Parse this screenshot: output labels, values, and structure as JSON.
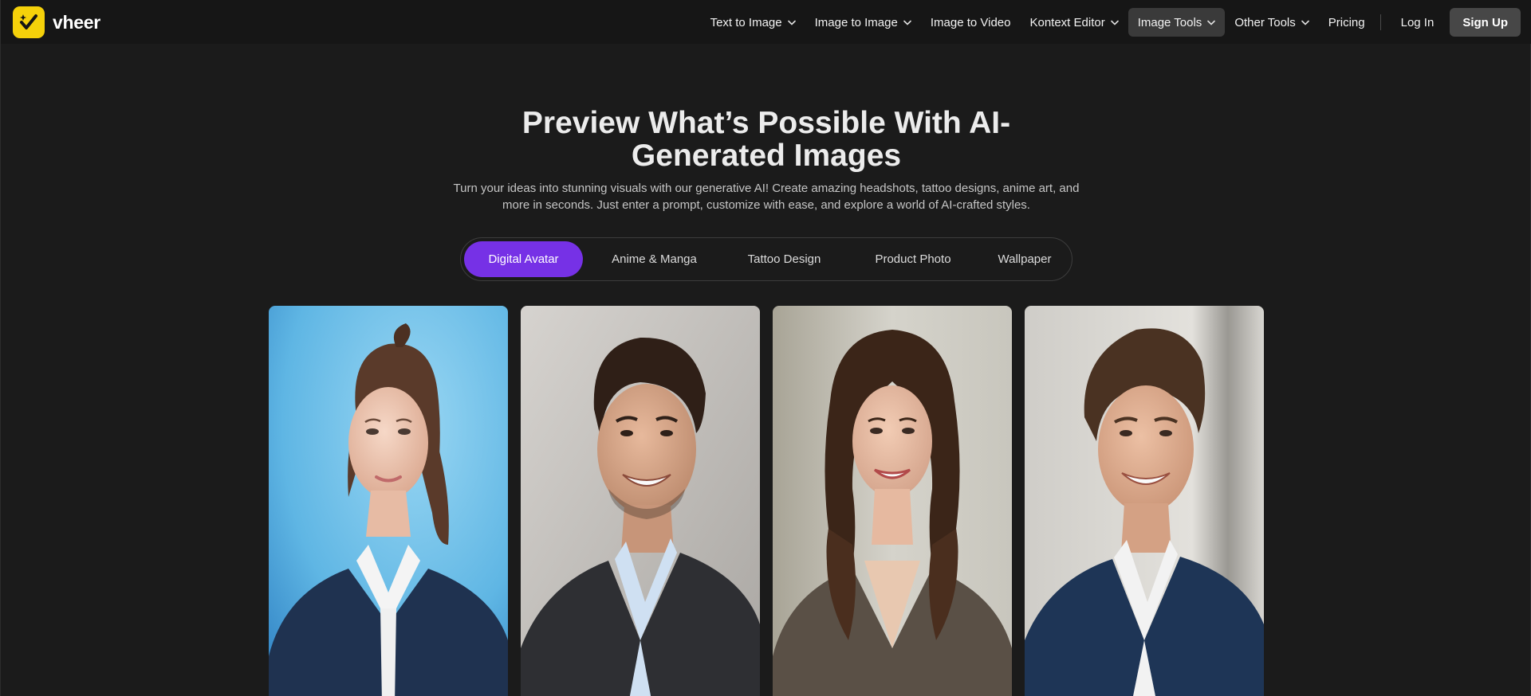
{
  "brand": {
    "name": "vheer",
    "logo_icon": "check-star-logo-icon",
    "logo_color": "#f5d10a"
  },
  "nav": {
    "items": [
      {
        "label": "Text to Image",
        "dropdown": true,
        "active": false
      },
      {
        "label": "Image to Image",
        "dropdown": true,
        "active": false
      },
      {
        "label": "Image to Video",
        "dropdown": false,
        "active": false
      },
      {
        "label": "Kontext Editor",
        "dropdown": true,
        "active": false
      },
      {
        "label": "Image Tools",
        "dropdown": true,
        "active": true
      },
      {
        "label": "Other Tools",
        "dropdown": true,
        "active": false
      },
      {
        "label": "Pricing",
        "dropdown": false,
        "active": false
      }
    ],
    "login_label": "Log In",
    "signup_label": "Sign Up"
  },
  "hero": {
    "title_line1": "Preview What’s Possible With AI-",
    "title_line2": "Generated Images",
    "subtitle_line1": "Turn your ideas into stunning visuals with our generative AI! Create amazing headshots, tattoo designs, anime art, and",
    "subtitle_line2": "more in seconds. Just enter a prompt, customize with ease, and explore a world of AI-crafted styles."
  },
  "tabs": {
    "items": [
      "Digital Avatar",
      "Anime & Manga",
      "Tattoo Design",
      "Product Photo",
      "Wallpaper"
    ],
    "active": "Digital Avatar",
    "accent_color": "#7631e6"
  },
  "gallery": {
    "images": [
      {
        "name": "avatar-woman-blue-background"
      },
      {
        "name": "avatar-man-grey-suit"
      },
      {
        "name": "avatar-woman-curly-hair"
      },
      {
        "name": "avatar-man-navy-suit"
      }
    ]
  }
}
